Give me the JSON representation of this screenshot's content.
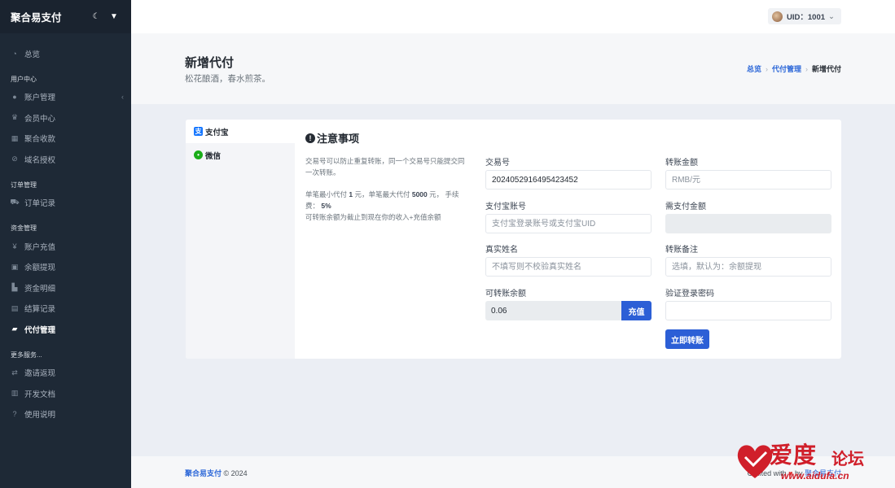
{
  "app": {
    "brand": "聚合易支付"
  },
  "sidebar": {
    "items_top": [
      {
        "label": "总览",
        "icon": "dashboard-icon"
      }
    ],
    "sections": [
      {
        "heading": "用户中心",
        "items": [
          {
            "label": "账户管理",
            "icon": "user-icon",
            "has_children": true
          },
          {
            "label": "会员中心",
            "icon": "crown-icon"
          },
          {
            "label": "聚合收款",
            "icon": "grid-icon"
          },
          {
            "label": "域名授权",
            "icon": "link-icon"
          }
        ]
      },
      {
        "heading": "订单管理",
        "items": [
          {
            "label": "订单记录",
            "icon": "cart-icon"
          }
        ]
      },
      {
        "heading": "资金管理",
        "items": [
          {
            "label": "账户充值",
            "icon": "yen-icon"
          },
          {
            "label": "余额提现",
            "icon": "wallet-icon"
          },
          {
            "label": "资金明细",
            "icon": "chart-icon"
          },
          {
            "label": "结算记录",
            "icon": "receipt-icon"
          },
          {
            "label": "代付管理",
            "icon": "payout-icon",
            "active": true
          }
        ]
      },
      {
        "heading": "更多服务...",
        "items": [
          {
            "label": "邀请返现",
            "icon": "invite-icon"
          },
          {
            "label": "开发文档",
            "icon": "book-icon"
          },
          {
            "label": "使用说明",
            "icon": "help-icon"
          }
        ]
      }
    ]
  },
  "topbar": {
    "user": "UID：1001"
  },
  "header": {
    "title": "新增代付",
    "subtitle": "松花酿酒，春水煎茶。",
    "breadcrumb": [
      "总览",
      "代付管理",
      "新增代付"
    ]
  },
  "tabs": [
    {
      "label": "支付宝",
      "icon": "alipay-icon",
      "active": true
    },
    {
      "label": "微信",
      "icon": "wechat-icon",
      "active": false
    }
  ],
  "notice": {
    "title": "注意事项",
    "line1": "交易号可以防止重复转账，同一个交易号只能提交同一次转账。",
    "line2_a": "单笔最小代付 ",
    "min": "1",
    "line2_b": " 元，单笔最大代付 ",
    "max": "5000",
    "line2_c": " 元，  手续费：  ",
    "fee": "5%",
    "line3": "可转账余额为截止到现在你的收入+充值余额"
  },
  "form": {
    "trade_no_label": "交易号",
    "trade_no_value": "2024052916495423452",
    "alipay_account_label": "支付宝账号",
    "alipay_account_placeholder": "支付宝登录账号或支付宝UID",
    "real_name_label": "真实姓名",
    "real_name_placeholder": "不填写则不校验真实姓名",
    "balance_label": "可转账余额",
    "balance_value": "0.06",
    "recharge_button": "充值",
    "amount_label": "转账金额",
    "amount_placeholder": "RMB/元",
    "pay_amount_label": "需支付金额",
    "remark_label": "转账备注",
    "remark_placeholder": "选填，默认为：余额提现",
    "password_label": "验证登录密码",
    "submit_button": "立即转账"
  },
  "footer": {
    "brand": "聚合易支付",
    "copyright": " © 2024",
    "crafted": "Crafted with ",
    "by": " by ",
    "by_brand": "聚合易支付"
  },
  "watermark": {
    "big": "爱度",
    "small": "论坛",
    "url": "www.aidufa.cn"
  },
  "colors": {
    "accent": "#2c5fd6",
    "sidebar": "#1e2936"
  }
}
